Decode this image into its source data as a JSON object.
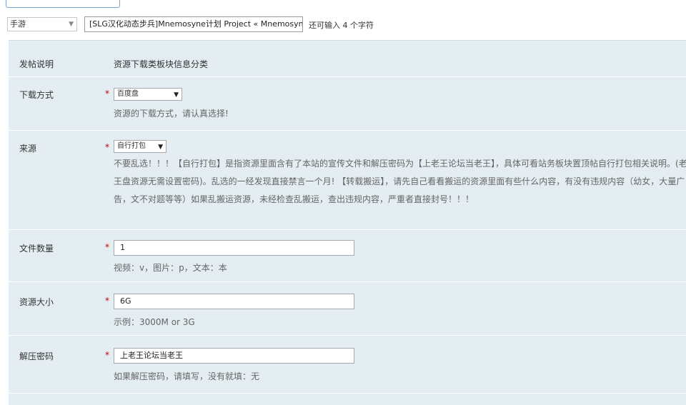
{
  "top": {
    "category_value": "手游",
    "title_value": "[SLG汉化动态步兵]Mnemosyne计划 Project « Mnemosyne",
    "remaining_text": "还可输入 4 个字符"
  },
  "form": {
    "intro": {
      "label": "发帖说明",
      "value": "资源下载类板块信息分类"
    },
    "download_method": {
      "label": "下载方式",
      "required": "*",
      "selected": "百度盘",
      "hint": "资源的下载方式，请认真选择!"
    },
    "source": {
      "label": "来源",
      "required": "*",
      "selected": "自行打包",
      "note": "不要乱选！！！【自行打包】是指资源里面含有了本站的宣传文件和解压密码为【上老王论坛当老王】，具体可看站务板块置顶帖自行打包相关说明。(老王盘资源无需设置密码)。乱选的一经发现直接禁言一个月! 【转载搬运】，请先自己看看搬运的资源里面有些什么内容，有没有违规内容（幼女，大量广告，文不对题等等）如果乱搬运资源，未经检查乱搬运，查出违规内容，严重者直接封号！！！"
    },
    "file_count": {
      "label": "文件数量",
      "required": "*",
      "value": "1",
      "hint": "视频：v，图片：p，文本：本"
    },
    "size": {
      "label": "资源大小",
      "required": "*",
      "value": "6G",
      "hint": "示例：3000M or 3G"
    },
    "password": {
      "label": "解压密码",
      "required": "*",
      "value": "上老王论坛当老王",
      "hint": "如果解压密码，请填写，没有就填：无"
    }
  }
}
